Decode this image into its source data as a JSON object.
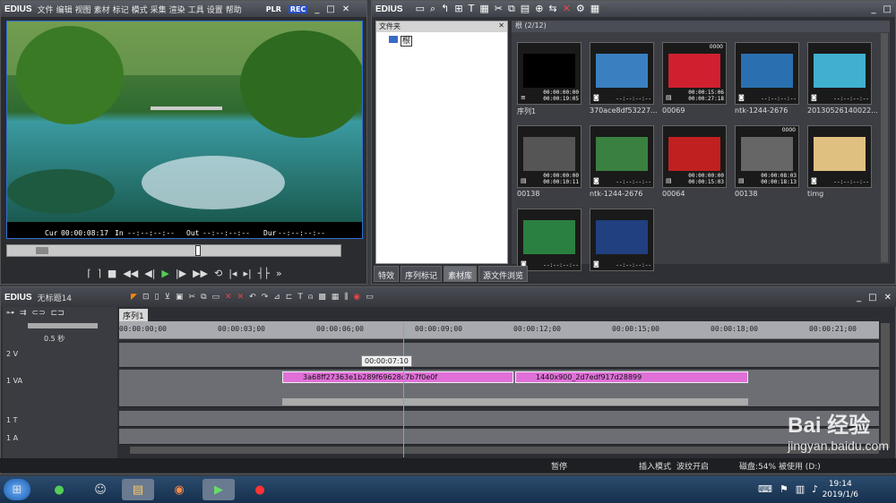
{
  "player": {
    "logo": "EDIUS",
    "menu": [
      "文件",
      "编辑",
      "视图",
      "素材",
      "标记",
      "模式",
      "采集",
      "渲染",
      "工具",
      "设置",
      "帮助"
    ],
    "plr": "PLR",
    "rec": "REC",
    "cur_label": "Cur",
    "cur": "00:00:08:17",
    "in_label": "In",
    "in": "--:--:--:--",
    "out_label": "Out",
    "out": "--:--:--:--",
    "dur_label": "Dur",
    "dur": "--:--:--:--"
  },
  "bin": {
    "logo": "EDIUS",
    "folder_title": "文件夹",
    "root_folder": "根",
    "path": "根 (2/12)",
    "clips": [
      {
        "label": "序列1",
        "tc1": "00:00:00:00",
        "tc2": "00:00:19:05",
        "top": "",
        "icon": "sequence"
      },
      {
        "label": "370ace8df53227...",
        "tc1": "--:--:--:--",
        "tc2": "",
        "top": "",
        "icon": "camera"
      },
      {
        "label": "00069",
        "tc1": "00:00:15:06",
        "tc2": "00:00:27:18",
        "top": "0000",
        "icon": "film"
      },
      {
        "label": "ntk-1244-2676",
        "tc1": "--:--:--:--",
        "tc2": "",
        "top": "",
        "icon": "camera"
      },
      {
        "label": "20130526140022...",
        "tc1": "--:--:--:--",
        "tc2": "",
        "top": "",
        "icon": "camera"
      },
      {
        "label": "00138",
        "tc1": "00:00:00:00",
        "tc2": "00:00:10:11",
        "top": "",
        "icon": "film"
      },
      {
        "label": "ntk-1244-2676",
        "tc1": "--:--:--:--",
        "tc2": "",
        "top": "",
        "icon": "camera"
      },
      {
        "label": "00064",
        "tc1": "00:00:00:00",
        "tc2": "00:00:15:03",
        "top": "",
        "icon": "film"
      },
      {
        "label": "00138",
        "tc1": "00:00:08:03",
        "tc2": "00:00:18:13",
        "top": "0000",
        "icon": "film"
      },
      {
        "label": "timg",
        "tc1": "--:--:--:--",
        "tc2": "",
        "top": "",
        "icon": "camera"
      },
      {
        "label": "",
        "tc1": "--:--:--:--",
        "tc2": "",
        "top": "",
        "icon": "camera"
      },
      {
        "label": "",
        "tc1": "--:--:--:--",
        "tc2": "",
        "top": "",
        "icon": "camera"
      }
    ],
    "tabs": [
      "特效",
      "序列标记",
      "素材库",
      "源文件浏览"
    ]
  },
  "timeline": {
    "logo": "EDIUS",
    "project": "无标题14",
    "sequence_tab": "序列1",
    "zoom": "0.5 秒",
    "ticks": [
      "00:00:00;00",
      "00:00:03;00",
      "00:00:06;00",
      "00:00:09;00",
      "00:00:12;00",
      "00:00:15;00",
      "00:00:18;00",
      "00:00:21;00"
    ],
    "tooltip": "00:00:07:10",
    "tracks": [
      "2 V",
      "1 VA",
      "1 T",
      "1 A"
    ],
    "clip1": "3a68ff27363e1b289f69628c7b7f0e0f",
    "clip2": "1440x900_2d7edf917d28899",
    "status": [
      "暂停",
      "插入模式",
      "波纹开启"
    ],
    "disk": "磁盘:54% 被使用 (D:)"
  },
  "taskbar": {
    "time": "19:14",
    "date": "2019/1/6"
  },
  "watermark": {
    "brand": "Bai  经验",
    "url": "jingyan.baidu.com"
  }
}
